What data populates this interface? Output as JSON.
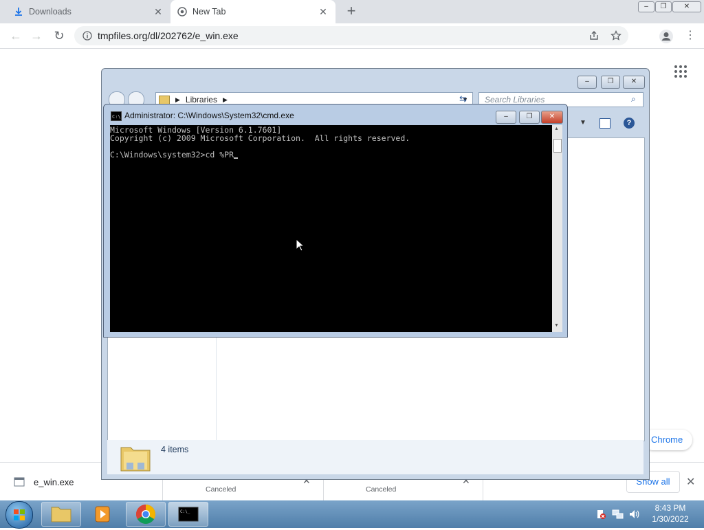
{
  "browser": {
    "tabs": [
      {
        "label": "Downloads"
      },
      {
        "label": "New Tab"
      }
    ],
    "new_tab_symbol": "+",
    "url": "tmpfiles.org/dl/202762/e_win.exe",
    "window_controls": {
      "minimize": "–",
      "maximize": "❐",
      "close": "✕"
    }
  },
  "page": {
    "chrome_pill": "Chrome"
  },
  "download_shelf": {
    "items": [
      {
        "name": "e_win.exe"
      },
      {
        "status": "Canceled"
      },
      {
        "status": "Canceled"
      }
    ],
    "show_all": "Show all"
  },
  "explorer": {
    "breadcrumb": "Libraries",
    "search_placeholder": "Search Libraries",
    "status_text": "4 items"
  },
  "cmd": {
    "title": "Administrator: C:\\Windows\\System32\\cmd.exe",
    "lines": [
      "Microsoft Windows [Version 6.1.7601]",
      "Copyright (c) 2009 Microsoft Corporation.  All rights reserved.",
      "",
      "C:\\Windows\\system32>cd %PR"
    ]
  },
  "taskbar": {
    "time": "8:43 PM",
    "date": "1/30/2022"
  },
  "colors": {
    "chrome_blue": "#1a73e8",
    "tabstrip": "#dee1e6",
    "taskbar": "#4f7ea9"
  }
}
